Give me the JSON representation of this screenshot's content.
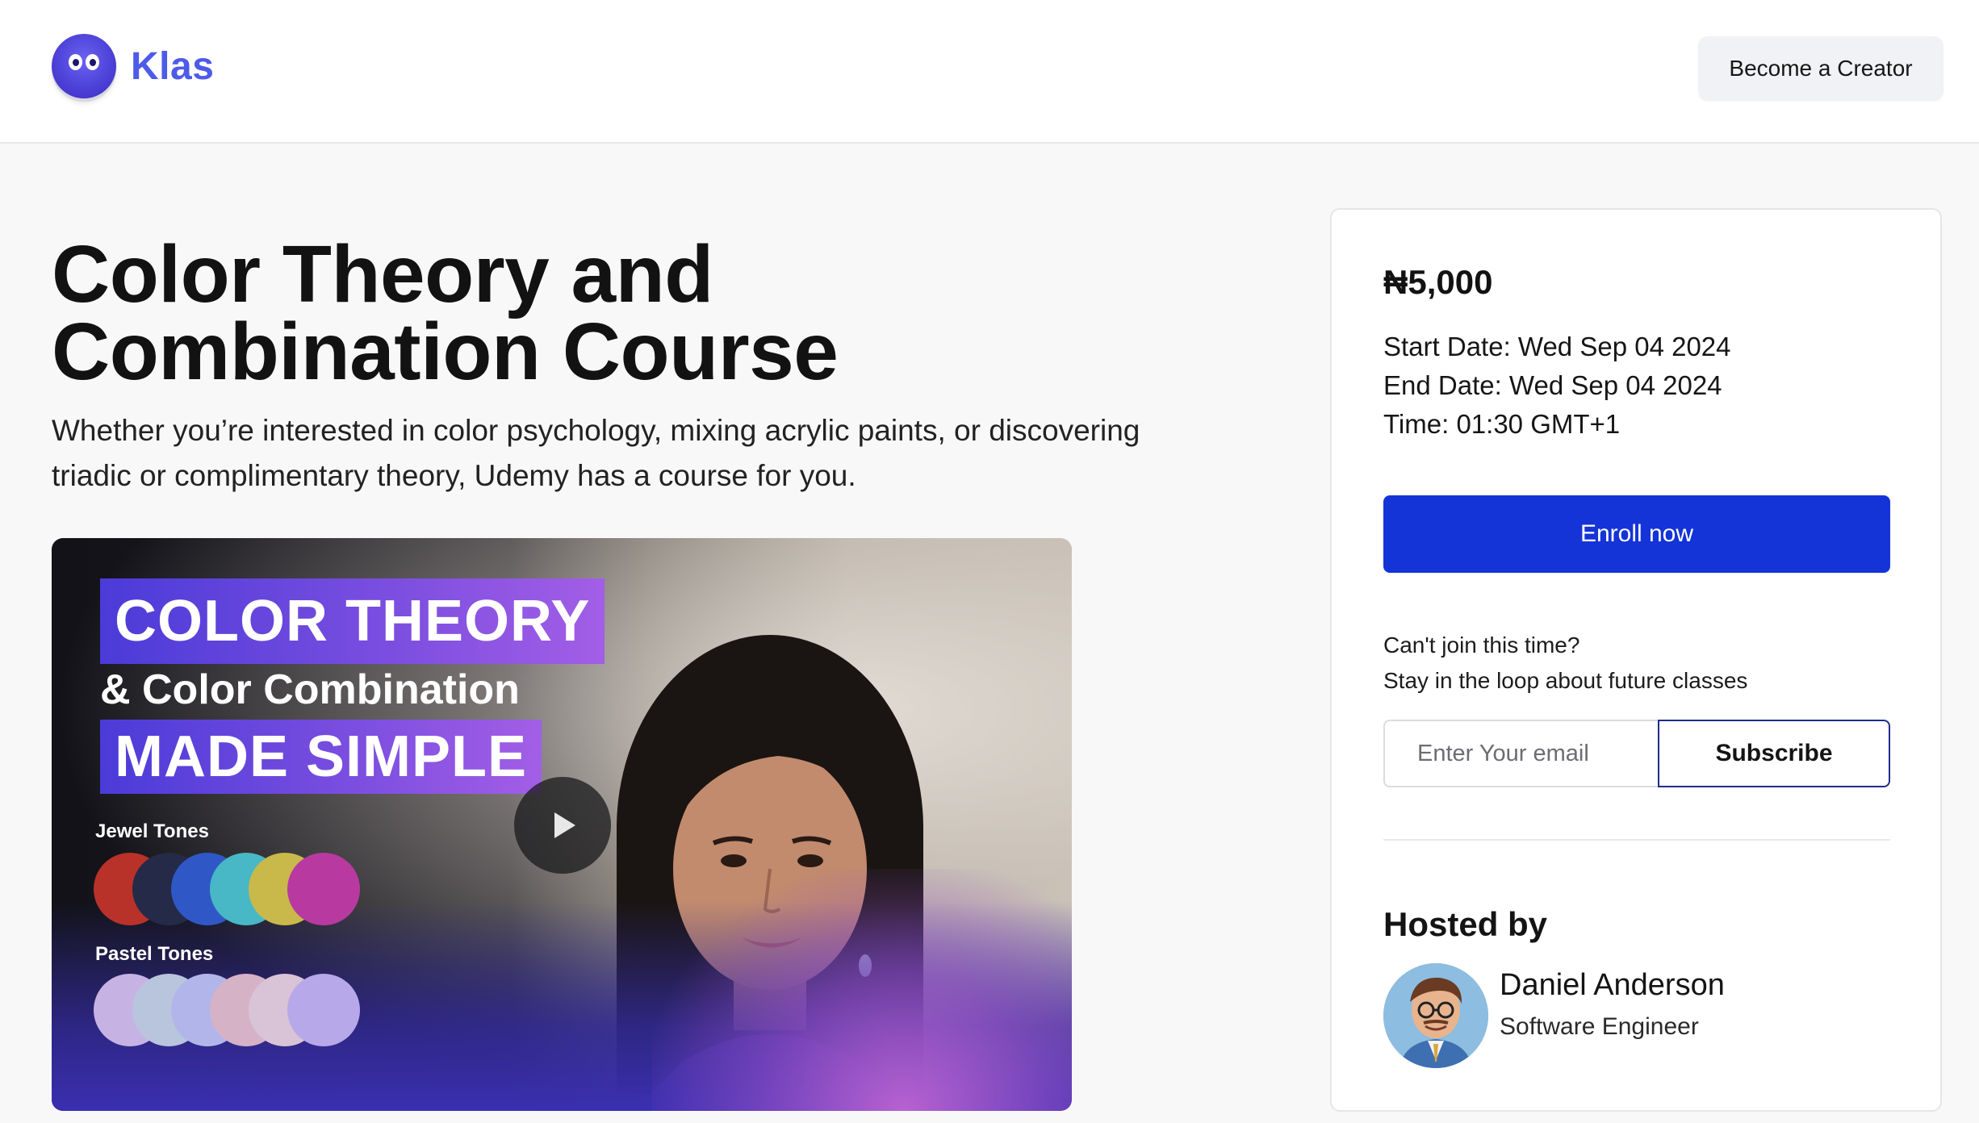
{
  "header": {
    "brand": "Klas",
    "cta_label": "Become a Creator"
  },
  "course": {
    "title_line1": "Color Theory and",
    "title_line2": "Combination Course",
    "description": "Whether you’re interested in color psychology, mixing acrylic paints, or discovering triadic or complimentary theory, Udemy has a course for you."
  },
  "video": {
    "banner1": "COLOR THEORY",
    "subline": "& Color Combination",
    "banner2": "MADE SIMPLE",
    "jewel_label": "Jewel Tones",
    "pastel_label": "Pastel Tones",
    "jewel_colors": [
      "#b8322a",
      "#252a48",
      "#2f58c6",
      "#48b8c6",
      "#c9b94a",
      "#b83aa0"
    ],
    "pastel_colors": [
      "#c7b3e3",
      "#b9c4dd",
      "#b2b5ea",
      "#d6b2c6",
      "#d9c3d6",
      "#b7a8ea"
    ],
    "play_icon": "play-icon"
  },
  "sidebar": {
    "price": "₦5,000",
    "start_date": "Start Date: Wed Sep 04 2024",
    "end_date": "End Date: Wed Sep 04 2024",
    "time": "Time: 01:30 GMT+1",
    "enroll_label": "Enroll now",
    "cant_join": "Can't join this time?",
    "stay_loop": "Stay in the loop about future classes",
    "email_placeholder": "Enter Your email",
    "subscribe_label": "Subscribe",
    "hosted_by": "Hosted by",
    "host_name": "Daniel Anderson",
    "host_role": "Software Engineer"
  },
  "colors": {
    "brand": "#4e5be8",
    "primary_button": "#1434d8",
    "subscribe_border": "#1f2b8f"
  }
}
